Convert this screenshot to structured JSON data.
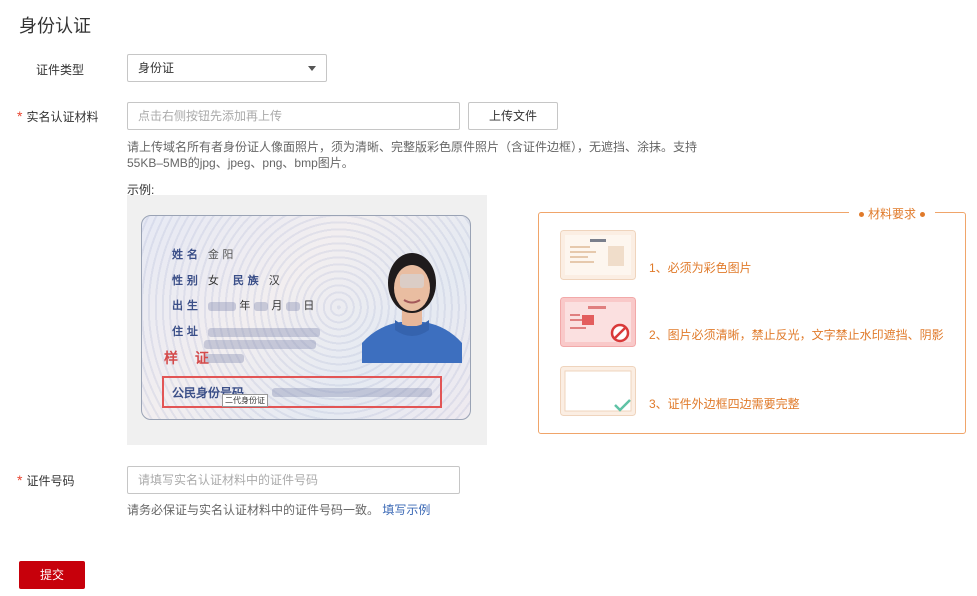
{
  "page": {
    "title": "身份认证"
  },
  "form": {
    "id_type": {
      "label": "证件类型",
      "value": "身份证"
    },
    "material": {
      "required_mark": "*",
      "label": "实名认证材料",
      "placeholder": "点击右侧按钮先添加再上传",
      "upload_button": "上传文件",
      "hint_line1": "请上传域名所有者身份证人像面照片，须为清晰、完整版彩色原件照片（含证件边框），无遮挡、涂抹。支持",
      "hint_line2": "55KB–5MB的jpg、jpeg、png、bmp图片。",
      "sample_label": "示例:"
    },
    "id_number": {
      "required_mark": "*",
      "label": "证件号码",
      "placeholder": "请填写实名认证材料中的证件号码",
      "hint": "请务必保证与实名认证材料中的证件号码一致。",
      "hint_link": "填写示例"
    },
    "submit_label": "提交"
  },
  "sample_card": {
    "name_label": "姓 名",
    "name_value": "金 阳",
    "gender_label": "性 别",
    "gender_value": "女",
    "ethnicity_label": "民 族",
    "ethnicity_value": "汉",
    "birth_label": "出 生",
    "birth_year_suffix": "年",
    "birth_month_suffix": "月",
    "birth_day_suffix": "日",
    "address_label": "住 址",
    "stamp": "样 证",
    "id_label": "公民身份号码",
    "id_tip": "二代身份证"
  },
  "requirements": {
    "title": "材料要求",
    "items": [
      {
        "text": "1、必须为彩色图片",
        "icon": "color-doc-icon"
      },
      {
        "text": "2、图片必须清晰，禁止反光，文字禁止水印遮挡、阴影",
        "icon": "blocked-doc-icon"
      },
      {
        "text": "3、证件外边框四边需要完整",
        "icon": "full-border-icon"
      }
    ]
  },
  "colors": {
    "accent": "#e07a2a",
    "submit": "#c7000b",
    "link": "#3a68b5",
    "required": "#e8432e"
  }
}
